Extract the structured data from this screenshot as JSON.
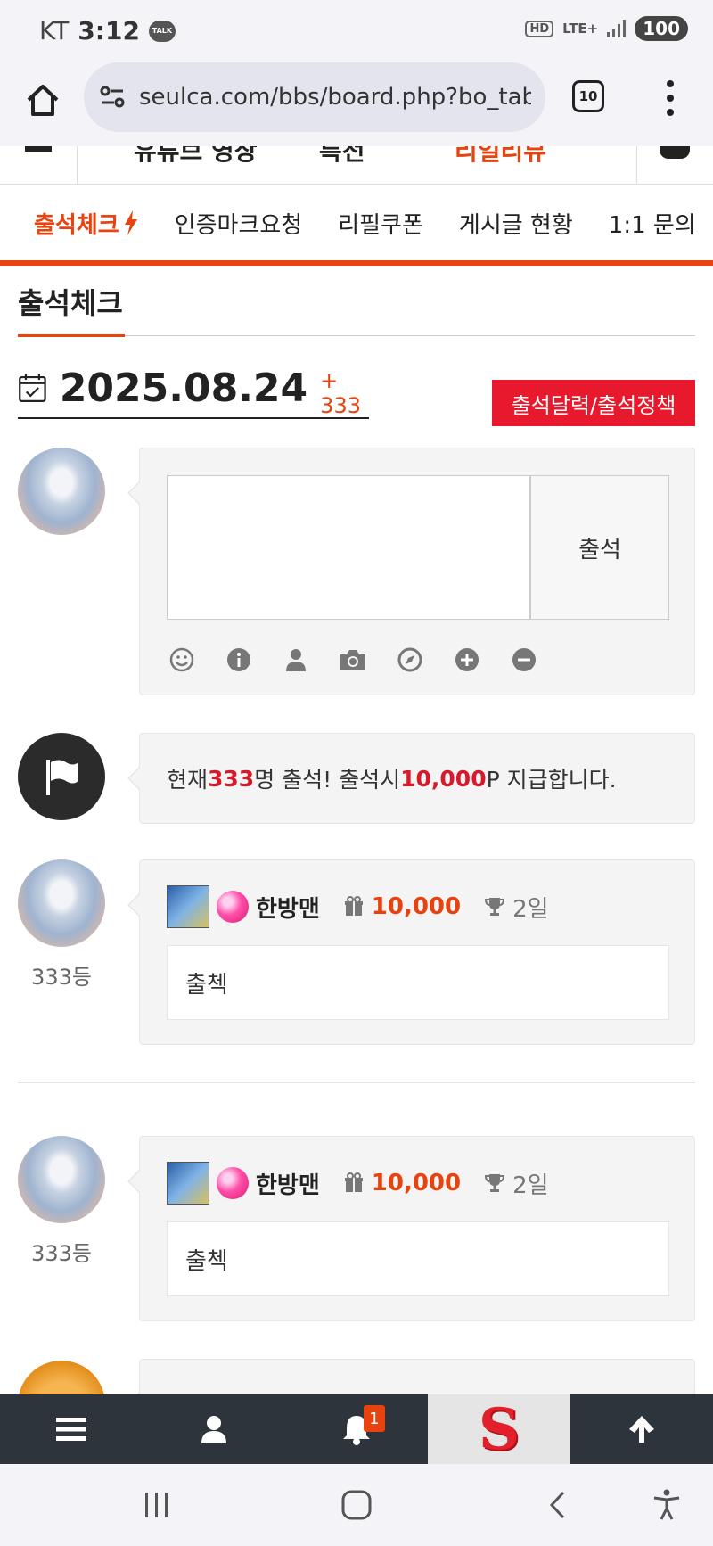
{
  "status_bar": {
    "carrier": "KT",
    "time": "3:12",
    "talk_badge": "TALK",
    "hd": "HD",
    "network": "LTE+",
    "battery": "100"
  },
  "browser": {
    "url": "seulca.com/bbs/board.php?bo_table",
    "tab_count": "10"
  },
  "site_nav": {
    "items": [
      "유튜브 영상",
      "특전",
      "리얼리뷰"
    ]
  },
  "sub_nav": {
    "items": [
      "출석체크",
      "인증마크요청",
      "리필쿠폰",
      "게시글 현황",
      "1:1 문의"
    ]
  },
  "page": {
    "title": "출석체크",
    "date": "2025.08.24",
    "count_label": "+ 333",
    "policy_button": "출석달력/출석정책"
  },
  "write_box": {
    "submit_label": "출석",
    "tools": [
      "smile-icon",
      "info-icon",
      "user-icon",
      "camera-icon",
      "compass-icon",
      "plus-icon",
      "minus-icon"
    ]
  },
  "notice": {
    "prefix": "현재 ",
    "count": "333",
    "mid": "명 출석! 출석시 ",
    "points": "10,000",
    "suffix": "P 지급합니다."
  },
  "comments": [
    {
      "rank": "333등",
      "nickname": "한방맨",
      "points": "10,000",
      "days": "2일",
      "text": "출첵"
    },
    {
      "rank": "333등",
      "nickname": "한방맨",
      "points": "10,000",
      "days": "2일",
      "text": "출첵"
    }
  ],
  "bottom_bar": {
    "notification_count": "1",
    "logo_letter": "S"
  },
  "colors": {
    "accent": "#e8420f",
    "button_red": "#e8192c",
    "bottom_bar": "#2d343b"
  }
}
